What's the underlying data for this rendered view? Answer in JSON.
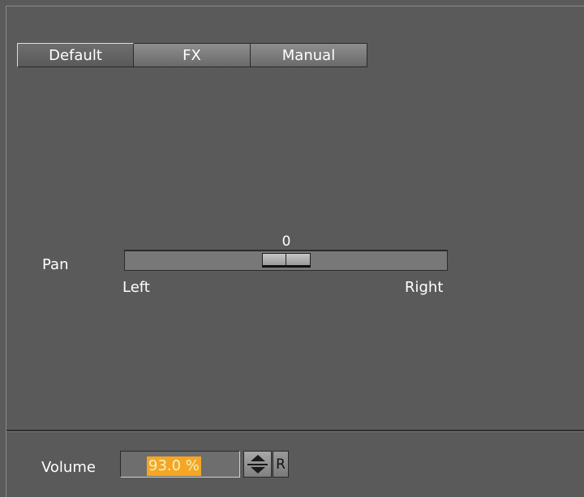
{
  "tabs": [
    {
      "label": "Default",
      "active": true
    },
    {
      "label": "FX",
      "active": false
    },
    {
      "label": "Manual",
      "active": false
    }
  ],
  "pan": {
    "label": "Pan",
    "value": "0",
    "left_label": "Left",
    "right_label": "Right",
    "position_fraction": 0.5
  },
  "volume": {
    "label": "Volume",
    "value": "93.0 %",
    "reset_label": "R"
  },
  "icons": {
    "stepper_up": "triangle-up-icon",
    "stepper_down": "triangle-down-icon"
  },
  "colors": {
    "background": "#5a5a5a",
    "highlight": "#f6a623"
  }
}
